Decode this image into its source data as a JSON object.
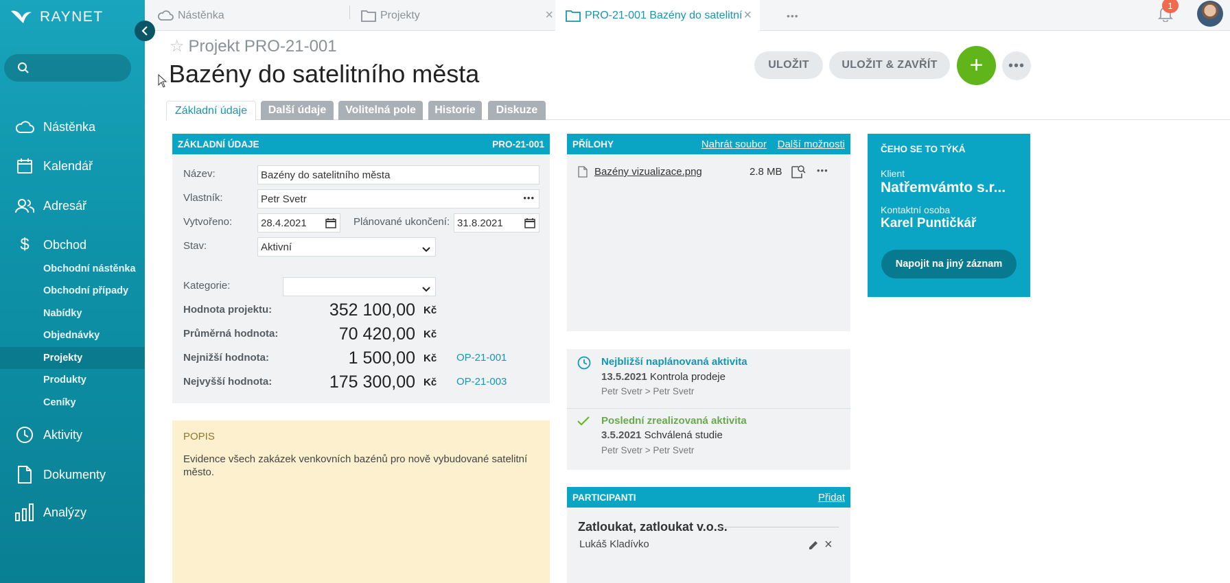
{
  "app": {
    "logo_text": "RAYNET"
  },
  "sidebar": {
    "search_placeholder": "",
    "items": [
      {
        "label": "Nástěnka"
      },
      {
        "label": "Kalendář"
      },
      {
        "label": "Adresář"
      },
      {
        "label": "Obchod"
      },
      {
        "label": "Aktivity"
      },
      {
        "label": "Dokumenty"
      },
      {
        "label": "Analýzy"
      }
    ],
    "subitems": [
      {
        "label": "Obchodní nástěnka"
      },
      {
        "label": "Obchodní případy"
      },
      {
        "label": "Nabídky"
      },
      {
        "label": "Objednávky"
      },
      {
        "label": "Projekty",
        "active": true
      },
      {
        "label": "Produkty"
      },
      {
        "label": "Ceníky"
      }
    ]
  },
  "tabs": [
    {
      "label": "Nástěnka"
    },
    {
      "label": "Projekty"
    },
    {
      "label": "PRO-21-001 Bazény do satelitní",
      "active": true
    }
  ],
  "notifications": {
    "count": "1"
  },
  "header": {
    "subtitle": "Projekt PRO-21-001",
    "title": "Bazény do satelitního města",
    "save_label": "ULOŽIT",
    "save_close_label": "ULOŽIT & ZAVŘÍT",
    "add_label": "+",
    "more_label": "•••"
  },
  "subtabs": [
    {
      "label": "Základní údaje",
      "active": true
    },
    {
      "label": "Další údaje"
    },
    {
      "label": "Volitelná pole"
    },
    {
      "label": "Historie"
    },
    {
      "label": "Diskuze"
    }
  ],
  "basic": {
    "heading": "ZÁKLADNÍ ÚDAJE",
    "code": "PRO-21-001",
    "name_label": "Název:",
    "name_value": "Bazény do satelitního města",
    "owner_label": "Vlastník:",
    "owner_value": "Petr Svetr",
    "created_label": "Vytvořeno:",
    "created_value": "28.4.2021",
    "planned_end_label": "Plánované ukončení:",
    "planned_end_value": "31.8.2021",
    "state_label": "Stav:",
    "state_value": "Aktivní",
    "category_label": "Kategorie:",
    "category_value": "",
    "value_label": "Hodnota projektu:",
    "value_value": "352 100,00",
    "avg_label": "Průměrná hodnota:",
    "avg_value": "70 420,00",
    "min_label": "Nejnižší hodnota:",
    "min_value": "1 500,00",
    "min_ref": "OP-21-001",
    "max_label": "Nejvyšší hodnota:",
    "max_value": "175 300,00",
    "max_ref": "OP-21-003",
    "currency": "Kč"
  },
  "popis": {
    "heading": "POPIS",
    "text": "Evidence všech zakázek venkovních bazénů pro nově vybudované satelitní město."
  },
  "attachments": {
    "heading": "PŘÍLOHY",
    "upload_link": "Nahrát soubor",
    "more_link": "Další možnosti",
    "files": [
      {
        "name": "Bazény vizualizace.png",
        "size": "2.8 MB"
      }
    ]
  },
  "activities": {
    "next_heading": "Nejbližší naplánovaná aktivita",
    "next_date": "13.5.2021",
    "next_title": "Kontrola prodeje",
    "next_people": "Petr Svetr > Petr Svetr",
    "last_heading": "Poslední zrealizovaná aktivita",
    "last_date": "3.5.2021",
    "last_title": "Schválená studie",
    "last_people": "Petr Svetr > Petr Svetr",
    "colors": {
      "next": "#1596b3",
      "last": "#5fb51a"
    }
  },
  "participants": {
    "heading": "PARTICIPANTI",
    "add_link": "Přidat",
    "company": "Zatloukat, zatloukat v.o.s.",
    "person": "Lukáš Kladívko"
  },
  "relation": {
    "heading": "ČEHO SE TO TÝKÁ",
    "client_label": "Klient",
    "client_value": "Natřemvámto s.r...",
    "contact_label": "Kontaktní osoba",
    "contact_value": "Karel Puntičkář",
    "connect_button": "Napojit na jiný záznam"
  }
}
